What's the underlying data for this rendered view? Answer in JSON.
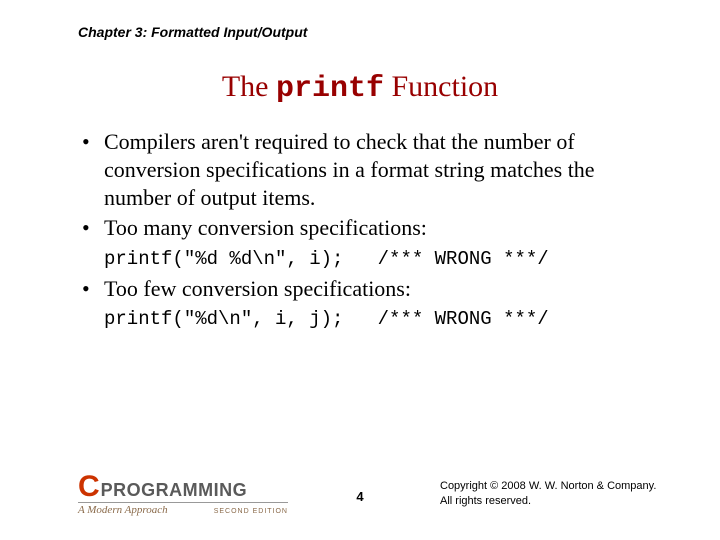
{
  "chapter": "Chapter 3: Formatted Input/Output",
  "title": {
    "pre": "The ",
    "code": "printf",
    "post": " Function"
  },
  "bullets": {
    "b1": "Compilers aren't required to check that the number of conversion specifications in a format string matches the number of output items.",
    "b2": "Too many conversion specifications:",
    "code1": "printf(\"%d %d\\n\", i);   /*** WRONG ***/",
    "b3": "Too few conversion specifications:",
    "code2": "printf(\"%d\\n\", i, j);   /*** WRONG ***/"
  },
  "footer": {
    "logo_c": "C",
    "logo_prog": "PROGRAMMING",
    "logo_sub": "A Modern Approach",
    "logo_edition": "SECOND EDITION",
    "page": "4",
    "copy1": "Copyright © 2008 W. W. Norton & Company.",
    "copy2": "All rights reserved."
  }
}
